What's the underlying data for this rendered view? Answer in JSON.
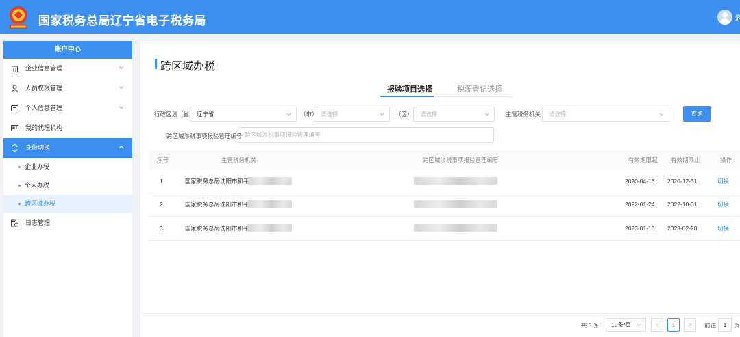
{
  "header": {
    "title": "国家税务总局辽宁省电子税务局",
    "user_name": "游"
  },
  "sidebar": {
    "heading": "账户中心",
    "items": [
      {
        "label": "企业信息管理",
        "icon": "building-icon"
      },
      {
        "label": "人员权限管理",
        "icon": "user-lock-icon"
      },
      {
        "label": "个人信息管理",
        "icon": "id-card-icon"
      },
      {
        "label": "我的代理机构",
        "icon": "agency-icon"
      },
      {
        "label": "身份切换",
        "icon": "switch-icon"
      },
      {
        "label": "日志管理",
        "icon": "log-icon"
      }
    ],
    "sub_items": [
      "企业办税",
      "个人办税",
      "跨区域办税"
    ]
  },
  "page": {
    "title": "跨区域办税",
    "tabs": [
      "报验项目选择",
      "税源登记选择"
    ]
  },
  "filters": {
    "province_label": "行政区划（省）",
    "province_value": "辽宁省",
    "city_label": "（市）",
    "city_placeholder": "请选择",
    "district_label": "（区）",
    "district_placeholder": "请选择",
    "authority_label": "主管税务机关",
    "authority_placeholder": "请选择",
    "query_button": "查询",
    "report_no_label": "跨区域涉税事项报验管理编号",
    "report_no_placeholder": "跨区域涉税事项报验管理编号"
  },
  "table": {
    "headers": [
      "序号",
      "主管税务机关",
      "跨区域涉税事项报验管理编号",
      "有效期限起",
      "有效期限止",
      "操作"
    ],
    "rows": [
      {
        "no": "1",
        "authority": "国家税务总局沈阳市和平区",
        "start": "2020-04-16",
        "end": "2020-12-31",
        "action": "切换"
      },
      {
        "no": "2",
        "authority": "国家税务总局沈阳市和平区",
        "start": "2022-01-24",
        "end": "2022-10-31",
        "action": "切换"
      },
      {
        "no": "3",
        "authority": "国家税务总局沈阳市和平区",
        "start": "2023-01-16",
        "end": "2023-02-28",
        "action": "切换"
      }
    ]
  },
  "pagination": {
    "total": "共 3 条",
    "page_size": "10条/页",
    "prev": "<",
    "current_page": "1",
    "next": ">",
    "goto_label": "前往",
    "goto_value": "1",
    "page_suffix": "页"
  },
  "colors": {
    "primary": "#3d8fef"
  }
}
